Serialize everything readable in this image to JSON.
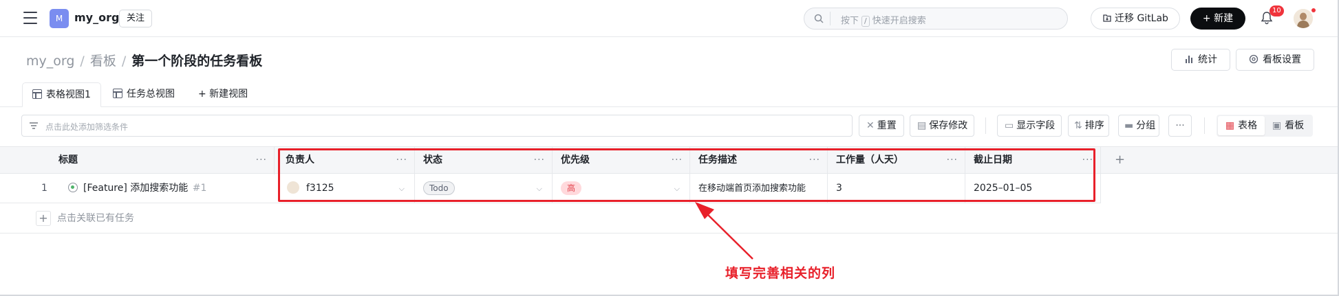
{
  "topbar": {
    "org_initial": "M",
    "org_name": "my_org",
    "follow_label": "关注",
    "search": {
      "placeholder_prefix": "按下",
      "shortcut_key": "/",
      "placeholder_suffix": "快速开启搜索"
    },
    "migrate_label": "迁移 GitLab",
    "new_label": "+ 新建",
    "notification_count": "10"
  },
  "breadcrumb": {
    "org": "my_org",
    "section": "看板",
    "current": "第一个阶段的任务看板",
    "separator": "/"
  },
  "header_actions": {
    "stats_label": "统计",
    "board_settings_label": "看板设置"
  },
  "view_tabs": [
    {
      "label": "表格视图1",
      "active": true
    },
    {
      "label": "任务总视图",
      "active": false
    },
    {
      "label": "+ 新建视图",
      "active": false
    }
  ],
  "toolbar": {
    "filter_placeholder": "点击此处添加筛选条件",
    "reset_label": "重置",
    "save_label": "保存修改",
    "fields_label": "显示字段",
    "sort_label": "排序",
    "group_label": "分组",
    "more_label": "···",
    "view_table_label": "表格",
    "view_board_label": "看板"
  },
  "table": {
    "columns": [
      "标题",
      "负责人",
      "状态",
      "优先级",
      "任务描述",
      "工作量（人天）",
      "截止日期"
    ],
    "column_more": "···",
    "add_column": "+",
    "rows": [
      {
        "index": "1",
        "title": "[Feature] 添加搜索功能",
        "issue_ref": "#1",
        "assignee": "f3125",
        "status": "Todo",
        "priority": "高",
        "description": "在移动端首页添加搜索功能",
        "effort": "3",
        "due_date": "2025–01–05"
      }
    ],
    "add_existing_label": "点击关联已有任务"
  },
  "annotation": {
    "text": "填写完善相关的列",
    "color": "#e8202a"
  },
  "colors": {
    "accent": "#0b0d10",
    "badge_red": "#f0343c",
    "org_badge": "#7a8df0",
    "priority_high_bg": "#ffd9dc"
  }
}
